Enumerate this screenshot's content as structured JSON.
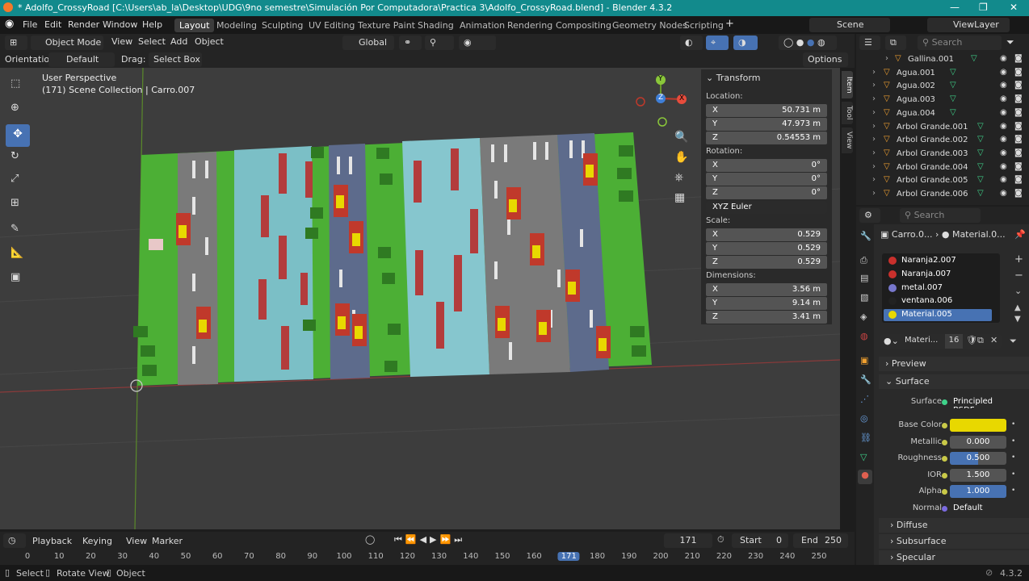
{
  "window": {
    "title": "* Adolfo_CrossyRoad [C:\\Users\\ab_la\\Desktop\\UDG\\9no semestre\\Simulación Por Computadora\\Practica 3\\Adolfo_CrossyRoad.blend] - Blender 4.3.2"
  },
  "menubar": {
    "items": [
      "File",
      "Edit",
      "Render",
      "Window",
      "Help"
    ],
    "workspaces": [
      "Layout",
      "Modeling",
      "Sculpting",
      "UV Editing",
      "Texture Paint",
      "Shading",
      "Animation",
      "Rendering",
      "Compositing",
      "Geometry Nodes",
      "Scripting"
    ],
    "scene": "Scene",
    "view_layer": "ViewLayer"
  },
  "viewport_header": {
    "mode": "Object Mode",
    "menus": [
      "View",
      "Select",
      "Add",
      "Object"
    ],
    "transform_orientation": "Global",
    "options": "Options",
    "orientation_label": "Orientation:",
    "orientation_value": "Default",
    "drag_label": "Drag:",
    "drag_value": "Select Box"
  },
  "viewport": {
    "perspective": "User Perspective",
    "collection": "(171) Scene Collection | Carro.007"
  },
  "gizmo": {
    "x": "X",
    "y": "Y",
    "z": "Z"
  },
  "npanel": {
    "section": "Transform",
    "location_label": "Location:",
    "location": [
      {
        "axis": "X",
        "value": "50.731 m"
      },
      {
        "axis": "Y",
        "value": "47.973 m"
      },
      {
        "axis": "Z",
        "value": "0.54553 m"
      }
    ],
    "rotation_label": "Rotation:",
    "rotation": [
      {
        "axis": "X",
        "value": "0°"
      },
      {
        "axis": "Y",
        "value": "0°"
      },
      {
        "axis": "Z",
        "value": "0°"
      }
    ],
    "rotation_mode": "XYZ Euler",
    "scale_label": "Scale:",
    "scale": [
      {
        "axis": "X",
        "value": "0.529"
      },
      {
        "axis": "Y",
        "value": "0.529"
      },
      {
        "axis": "Z",
        "value": "0.529"
      }
    ],
    "dimensions_label": "Dimensions:",
    "dimensions": [
      {
        "axis": "X",
        "value": "3.56 m"
      },
      {
        "axis": "Y",
        "value": "9.14 m"
      },
      {
        "axis": "Z",
        "value": "3.41 m"
      }
    ],
    "tabs": [
      "Item",
      "Tool",
      "View"
    ]
  },
  "outliner": {
    "search_placeholder": "Search",
    "items": [
      "Gallina.001",
      "Agua.001",
      "Agua.002",
      "Agua.003",
      "Agua.004",
      "Arbol Grande.001",
      "Arbol Grande.002",
      "Arbol Grande.003",
      "Arbol Grande.004",
      "Arbol Grande.005",
      "Arbol Grande.006"
    ]
  },
  "properties": {
    "search_placeholder": "Search",
    "breadcrumb_object": "Carro.0...",
    "breadcrumb_material": "Material.0...",
    "materials": [
      "Naranja2.007",
      "Naranja.007",
      "metal.007",
      "ventana.006",
      "Material.005"
    ],
    "material_colors": [
      "#c9302c",
      "#c9302c",
      "#7777cc",
      "#222222",
      "#e8d800"
    ],
    "active_material": "Materi...",
    "users": "16",
    "preview": "Preview",
    "surface_section": "Surface",
    "surface_label": "Surface",
    "surface_value": "Principled BSDF",
    "base_color_label": "Base Color",
    "base_color": "#e8d800",
    "metallic_label": "Metallic",
    "metallic": "0.000",
    "roughness_label": "Roughness",
    "roughness": "0.500",
    "roughness_fill": 0.5,
    "ior_label": "IOR",
    "ior": "1.500",
    "alpha_label": "Alpha",
    "alpha": "1.000",
    "alpha_fill": 1.0,
    "normal_label": "Normal",
    "normal": "Default",
    "subpanels": [
      "Diffuse",
      "Subsurface",
      "Specular"
    ]
  },
  "timeline": {
    "menus": [
      "Playback",
      "Keying",
      "View",
      "Marker"
    ],
    "current_frame": "171",
    "start_label": "Start",
    "start": "0",
    "end_label": "End",
    "end": "250",
    "ruler": [
      "0",
      "10",
      "20",
      "30",
      "40",
      "50",
      "60",
      "70",
      "80",
      "90",
      "100",
      "110",
      "120",
      "130",
      "140",
      "150",
      "160",
      "171",
      "180",
      "190",
      "200",
      "210",
      "220",
      "230",
      "240",
      "250"
    ]
  },
  "statusbar": {
    "select": "Select",
    "rotate": "Rotate View",
    "object": "Object",
    "version": "4.3.2"
  }
}
